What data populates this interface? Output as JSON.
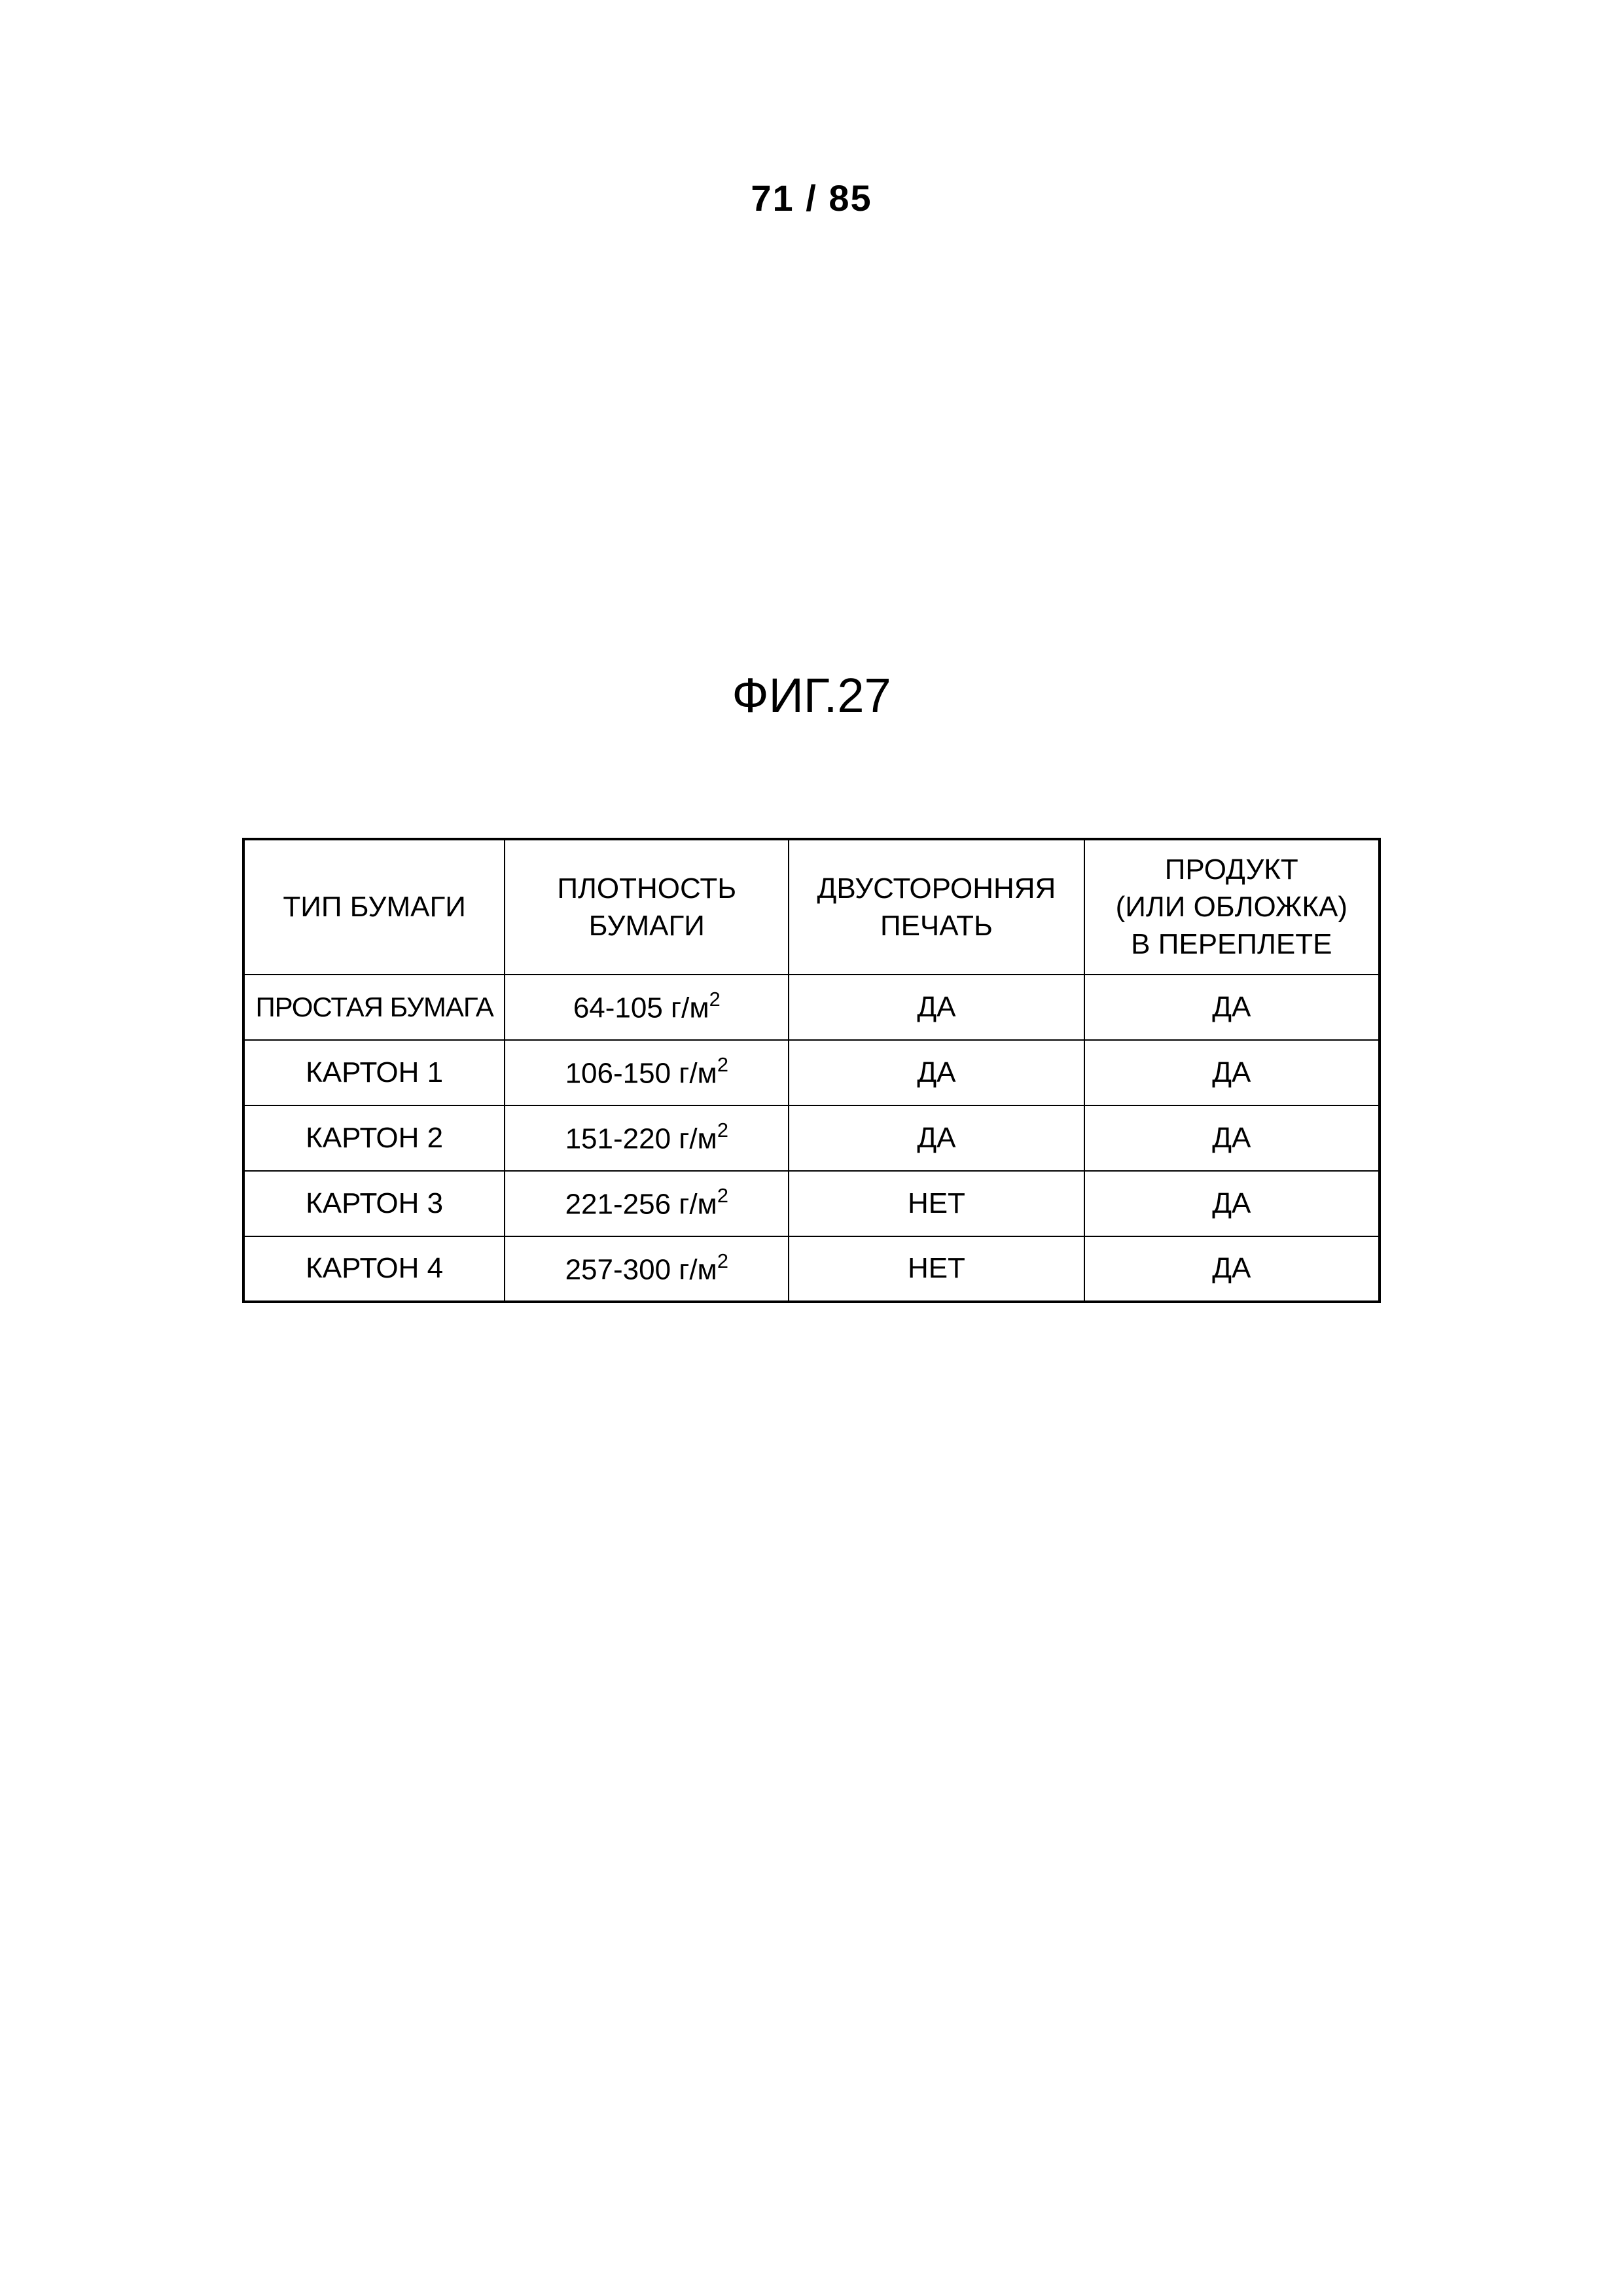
{
  "page_number": "71 / 85",
  "figure_label": "ФИГ.27",
  "table": {
    "headers": {
      "col1": "ТИП БУМАГИ",
      "col2": "ПЛОТНОСТЬ БУМАГИ",
      "col3": "ДВУСТОРОННЯЯ ПЕЧАТЬ",
      "col4_line1": "ПРОДУКТ",
      "col4_line2": "(ИЛИ ОБЛОЖКА)",
      "col4_line3": "В ПЕРЕПЛЕТЕ"
    },
    "density_unit_prefix": " г/м",
    "density_unit_exponent": "2",
    "rows": [
      {
        "paper_type": "ПРОСТАЯ БУМАГА",
        "density_range": "64-105",
        "duplex": "ДА",
        "binding": "ДА"
      },
      {
        "paper_type": "КАРТОН 1",
        "density_range": "106-150",
        "duplex": "ДА",
        "binding": "ДА"
      },
      {
        "paper_type": "КАРТОН 2",
        "density_range": "151-220",
        "duplex": "ДА",
        "binding": "ДА"
      },
      {
        "paper_type": "КАРТОН 3",
        "density_range": "221-256",
        "duplex": "НЕТ",
        "binding": "ДА"
      },
      {
        "paper_type": "КАРТОН 4",
        "density_range": "257-300",
        "duplex": "НЕТ",
        "binding": "ДА"
      }
    ]
  }
}
